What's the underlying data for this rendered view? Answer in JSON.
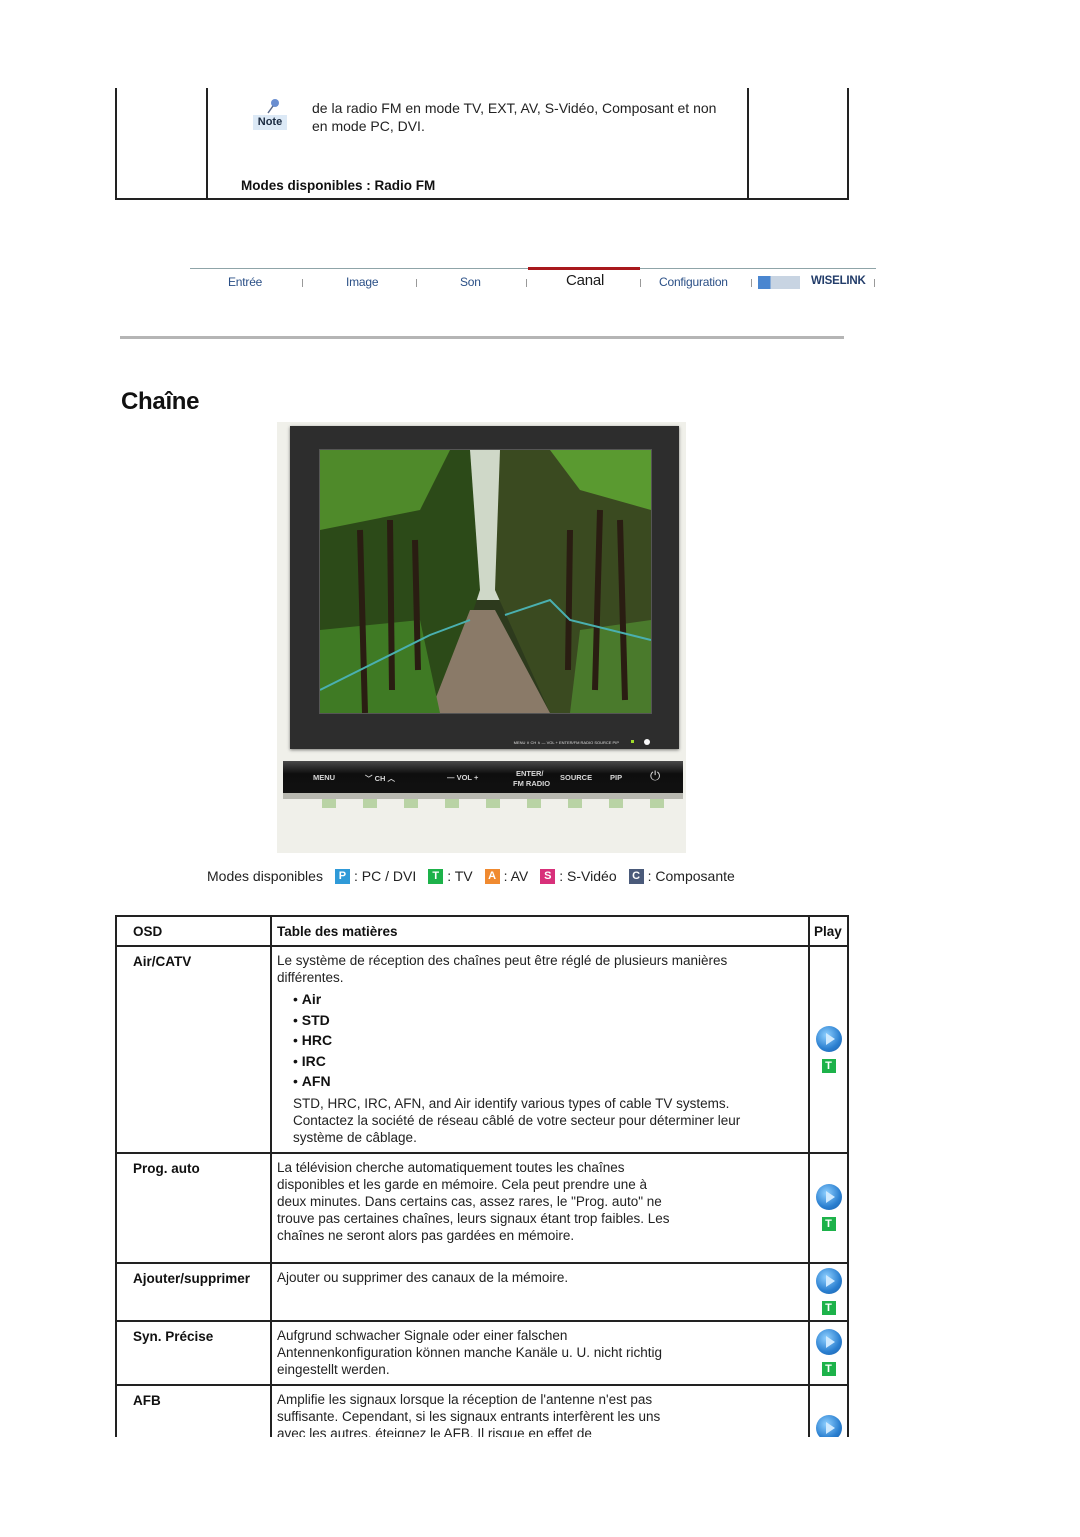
{
  "top_fragment": {
    "note_label": "Note",
    "note_text": "de la radio FM en mode TV, EXT, AV, S-Vidéo, Composant et non en mode PC, DVI.",
    "modes_label": "Modes disponibles : Radio FM"
  },
  "nav": {
    "items": [
      {
        "label": "Entrée",
        "active": false
      },
      {
        "label": "Image",
        "active": false
      },
      {
        "label": "Son",
        "active": false
      },
      {
        "label": "Canal",
        "active": true
      },
      {
        "label": "Configuration",
        "active": false
      },
      {
        "label": "WISELINK",
        "active": false
      }
    ],
    "active_color": "#a8181c"
  },
  "page_title": "Chaîne",
  "monitor": {
    "bezel_labels": "MENU  ∨ CH ∧   — VOL +  ENTER/FM RADIO  SOURCE  PIP",
    "control_bar": {
      "menu": "MENU",
      "ch": "﹀  CH  ︿",
      "vol": "—  VOL  +",
      "enter": "ENTER/",
      "fm_radio": "FM RADIO",
      "source": "SOURCE",
      "pip": "PIP",
      "power": "⏻"
    }
  },
  "modes_legend": {
    "prefix": "Modes disponibles",
    "items": [
      {
        "badge": "P",
        "color": "#2f9ad8",
        "label": ": PC / DVI"
      },
      {
        "badge": "T",
        "color": "#1db24a",
        "label": ": TV"
      },
      {
        "badge": "A",
        "color": "#f08a30",
        "label": ": AV"
      },
      {
        "badge": "S",
        "color": "#d8307a",
        "label": ": S-Vidéo"
      },
      {
        "badge": "C",
        "color": "#4a5a7a",
        "label": ": Composante"
      }
    ]
  },
  "table": {
    "headers": [
      "OSD",
      "Table des matières",
      "Play"
    ],
    "rows": [
      {
        "osd": "Air/CATV",
        "text": "Le système de réception des chaînes peut être réglé de plusieurs manières différentes.",
        "options": [
          "Air",
          "STD",
          "HRC",
          "IRC",
          "AFN"
        ],
        "after": "STD, HRC, IRC, AFN, and Air identify various types of cable TV systems. Contactez la société de réseau câblé de votre secteur pour déterminer leur système de câblage.",
        "modes": [
          "T"
        ]
      },
      {
        "osd": "Prog. auto",
        "text": "La télévision cherche automatiquement toutes les chaînes disponibles et les garde en mémoire. Cela peut prendre une à deux minutes. Dans certains cas, assez rares, le \"Prog. auto\" ne trouve pas certaines chaînes, leurs signaux étant trop faibles. Les chaînes ne seront alors pas gardées en mémoire.",
        "modes": [
          "T"
        ]
      },
      {
        "osd": "Ajouter/supprimer",
        "text": "Ajouter ou supprimer des canaux de la mémoire.",
        "modes": [
          "T"
        ]
      },
      {
        "osd": "Syn. Précise",
        "text": "Aufgrund schwacher Signale oder einer falschen Antennenkonfiguration können manche Kanäle u. U. nicht richtig eingestellt werden.",
        "modes": [
          "T"
        ]
      },
      {
        "osd": "AFB",
        "text": "Amplifie les signaux lorsque la réception de l'antenne n'est pas suffisante. Cependant, si les signaux entrants interfèrent les uns avec les autres, éteignez le AFB. Il risque en effet de",
        "modes": []
      }
    ]
  }
}
